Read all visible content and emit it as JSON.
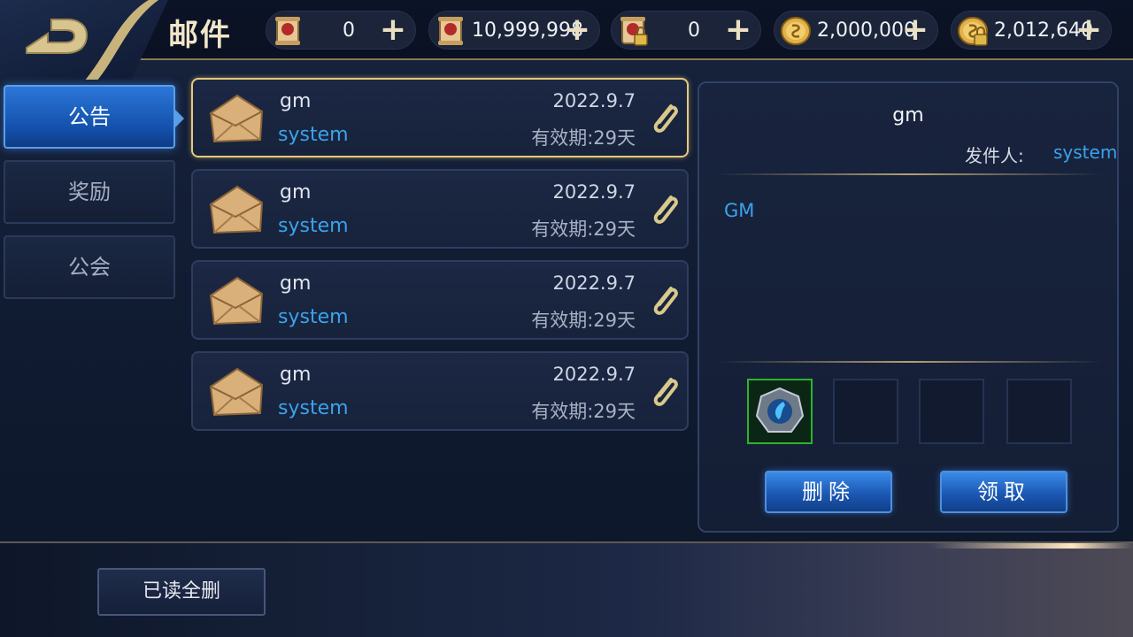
{
  "header": {
    "title": "邮件",
    "resources": [
      {
        "icon": "red-scroll-icon",
        "value": "0"
      },
      {
        "icon": "red-scroll-icon",
        "value": "10,999,998"
      },
      {
        "icon": "locked-scroll-icon",
        "value": "0"
      },
      {
        "icon": "gold-coin-icon",
        "value": "2,000,000"
      },
      {
        "icon": "locked-gold-coin-icon",
        "value": "2,012,640"
      }
    ],
    "plus_symbol": "+"
  },
  "tabs": [
    {
      "label": "公告",
      "active": true
    },
    {
      "label": "奖励",
      "active": false
    },
    {
      "label": "公会",
      "active": false
    }
  ],
  "mails": [
    {
      "sender": "gm",
      "from": "system",
      "date": "2022.9.7",
      "expire": "有效期:29天",
      "selected": true
    },
    {
      "sender": "gm",
      "from": "system",
      "date": "2022.9.7",
      "expire": "有效期:29天",
      "selected": false
    },
    {
      "sender": "gm",
      "from": "system",
      "date": "2022.9.7",
      "expire": "有效期:29天",
      "selected": false
    },
    {
      "sender": "gm",
      "from": "system",
      "date": "2022.9.7",
      "expire": "有效期:29天",
      "selected": false
    }
  ],
  "detail": {
    "title": "gm",
    "sender_label": "发件人:",
    "sender_value": "system",
    "body": "GM",
    "delete_label": "删除",
    "claim_label": "领取"
  },
  "footer": {
    "read_all_delete_label": "已读全删"
  },
  "colors": {
    "accent_blue": "#3aa3ec",
    "gold": "#e7c97a",
    "active_tab": "#1b58b4"
  }
}
